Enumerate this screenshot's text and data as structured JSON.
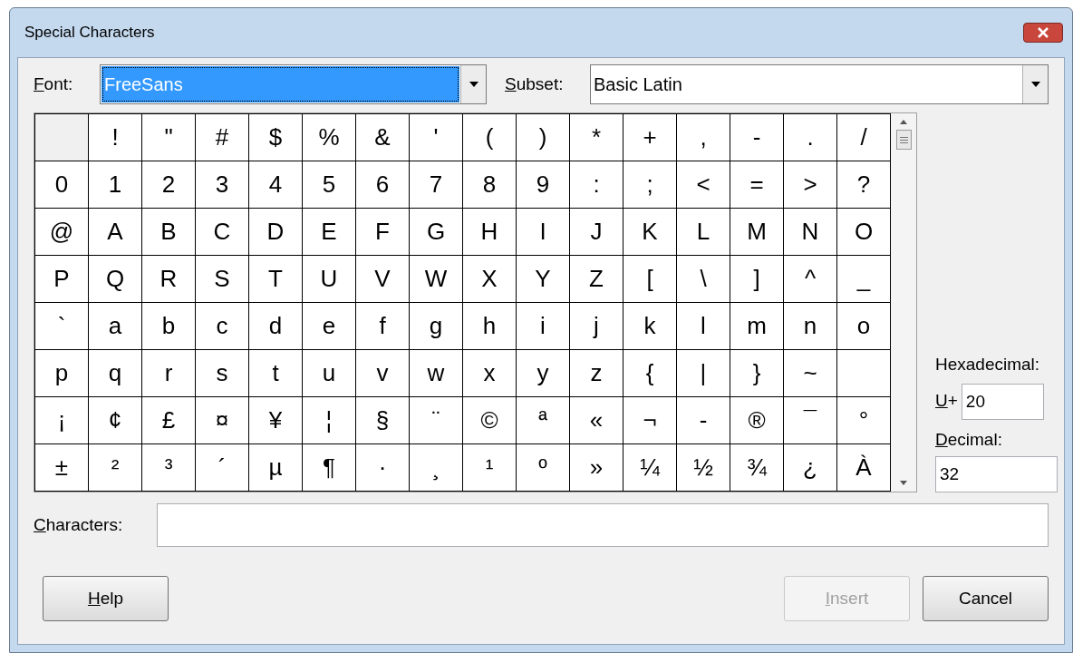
{
  "window": {
    "title": "Special Characters"
  },
  "font": {
    "label": "Font:",
    "mnemonic": true,
    "value": "FreeSans",
    "focused": true
  },
  "subset": {
    "label": "Subset:",
    "mnemonic": true,
    "value": "Basic Latin",
    "focused": false
  },
  "grid": {
    "rows": [
      [
        {
          "selected": true
        },
        {
          "char": "!",
          "selected": false
        },
        {
          "char": "\"",
          "selected": false
        },
        {
          "char": "#",
          "selected": false
        },
        {
          "char": "$",
          "selected": false
        },
        {
          "char": "%",
          "selected": false
        },
        {
          "char": "&",
          "selected": false
        },
        {
          "char": "'",
          "selected": false
        },
        {
          "char": "(",
          "selected": false
        },
        {
          "char": ")",
          "selected": false
        },
        {
          "char": "*",
          "selected": false
        },
        {
          "char": "+",
          "selected": false
        },
        {
          "char": ",",
          "selected": false
        },
        {
          "char": "-",
          "selected": false
        },
        {
          "char": ".",
          "selected": false
        },
        {
          "char": "/",
          "selected": false
        }
      ],
      [
        {
          "char": "0",
          "selected": false
        },
        {
          "char": "1",
          "selected": false
        },
        {
          "char": "2",
          "selected": false
        },
        {
          "char": "3",
          "selected": false
        },
        {
          "char": "4",
          "selected": false
        },
        {
          "char": "5",
          "selected": false
        },
        {
          "char": "6",
          "selected": false
        },
        {
          "char": "7",
          "selected": false
        },
        {
          "char": "8",
          "selected": false
        },
        {
          "char": "9",
          "selected": false
        },
        {
          "char": ":",
          "selected": false
        },
        {
          "char": ";",
          "selected": false
        },
        {
          "char": "<",
          "selected": false
        },
        {
          "char": "=",
          "selected": false
        },
        {
          "char": ">",
          "selected": false
        },
        {
          "char": "?",
          "selected": false
        }
      ],
      [
        {
          "char": "@",
          "selected": false
        },
        {
          "char": "A",
          "selected": false
        },
        {
          "char": "B",
          "selected": false
        },
        {
          "char": "C",
          "selected": false
        },
        {
          "char": "D",
          "selected": false
        },
        {
          "char": "E",
          "selected": false
        },
        {
          "char": "F",
          "selected": false
        },
        {
          "char": "G",
          "selected": false
        },
        {
          "char": "H",
          "selected": false
        },
        {
          "char": "I",
          "selected": false
        },
        {
          "char": "J",
          "selected": false
        },
        {
          "char": "K",
          "selected": false
        },
        {
          "char": "L",
          "selected": false
        },
        {
          "char": "M",
          "selected": false
        },
        {
          "char": "N",
          "selected": false
        },
        {
          "char": "O",
          "selected": false
        }
      ],
      [
        {
          "char": "P",
          "selected": false
        },
        {
          "char": "Q",
          "selected": false
        },
        {
          "char": "R",
          "selected": false
        },
        {
          "char": "S",
          "selected": false
        },
        {
          "char": "T",
          "selected": false
        },
        {
          "char": "U",
          "selected": false
        },
        {
          "char": "V",
          "selected": false
        },
        {
          "char": "W",
          "selected": false
        },
        {
          "char": "X",
          "selected": false
        },
        {
          "char": "Y",
          "selected": false
        },
        {
          "char": "Z",
          "selected": false
        },
        {
          "char": "[",
          "selected": false
        },
        {
          "char": "\\",
          "selected": false
        },
        {
          "char": "]",
          "selected": false
        },
        {
          "char": "^",
          "selected": false
        },
        {
          "char": "_",
          "selected": false
        }
      ],
      [
        {
          "char": "`",
          "selected": false
        },
        {
          "char": "a",
          "selected": false
        },
        {
          "char": "b",
          "selected": false
        },
        {
          "char": "c",
          "selected": false
        },
        {
          "char": "d",
          "selected": false
        },
        {
          "char": "e",
          "selected": false
        },
        {
          "char": "f",
          "selected": false
        },
        {
          "char": "g",
          "selected": false
        },
        {
          "char": "h",
          "selected": false
        },
        {
          "char": "i",
          "selected": false
        },
        {
          "char": "j",
          "selected": false
        },
        {
          "char": "k",
          "selected": false
        },
        {
          "char": "l",
          "selected": false
        },
        {
          "char": "m",
          "selected": false
        },
        {
          "char": "n",
          "selected": false
        },
        {
          "char": "o",
          "selected": false
        }
      ],
      [
        {
          "char": "p",
          "selected": false
        },
        {
          "char": "q",
          "selected": false
        },
        {
          "char": "r",
          "selected": false
        },
        {
          "char": "s",
          "selected": false
        },
        {
          "char": "t",
          "selected": false
        },
        {
          "char": "u",
          "selected": false
        },
        {
          "char": "v",
          "selected": false
        },
        {
          "char": "w",
          "selected": false
        },
        {
          "char": "x",
          "selected": false
        },
        {
          "char": "y",
          "selected": false
        },
        {
          "char": "z",
          "selected": false
        },
        {
          "char": "{",
          "selected": false
        },
        {
          "char": "|",
          "selected": false
        },
        {
          "char": "}",
          "selected": false
        },
        {
          "char": "~",
          "selected": false
        },
        {
          "selected": false
        }
      ],
      [
        {
          "char": "¡",
          "selected": false
        },
        {
          "char": "¢",
          "selected": false
        },
        {
          "char": "£",
          "selected": false
        },
        {
          "char": "¤",
          "selected": false
        },
        {
          "char": "¥",
          "selected": false
        },
        {
          "char": "¦",
          "selected": false
        },
        {
          "char": "§",
          "selected": false
        },
        {
          "char": "¨",
          "selected": false
        },
        {
          "char": "©",
          "selected": false
        },
        {
          "char": "ª",
          "selected": false
        },
        {
          "char": "«",
          "selected": false
        },
        {
          "char": "¬",
          "selected": false
        },
        {
          "char": "-",
          "selected": false
        },
        {
          "char": "®",
          "selected": false
        },
        {
          "char": "¯",
          "selected": false
        },
        {
          "char": "°",
          "selected": false
        }
      ],
      [
        {
          "char": "±",
          "selected": false
        },
        {
          "char": "²",
          "selected": false
        },
        {
          "char": "³",
          "selected": false
        },
        {
          "char": "´",
          "selected": false
        },
        {
          "char": "µ",
          "selected": false
        },
        {
          "char": "¶",
          "selected": false
        },
        {
          "char": "·",
          "selected": false
        },
        {
          "char": "¸",
          "selected": false
        },
        {
          "char": "¹",
          "selected": false
        },
        {
          "char": "º",
          "selected": false
        },
        {
          "char": "»",
          "selected": false
        },
        {
          "char": "¼",
          "selected": false
        },
        {
          "char": "½",
          "selected": false
        },
        {
          "char": "¾",
          "selected": false
        },
        {
          "char": "¿",
          "selected": false
        },
        {
          "char": "À",
          "selected": false
        }
      ]
    ]
  },
  "hexadecimal": {
    "label": "Hexadecimal:",
    "prefix": "U+",
    "mnemonic": true,
    "value": "20"
  },
  "decimal": {
    "label": "Decimal:",
    "mnemonic": true,
    "value": "32"
  },
  "characters": {
    "label": "Characters:",
    "mnemonic": true
  },
  "buttons": [
    {
      "label": "Help",
      "mnemonic": true,
      "disabled": false
    },
    {
      "label": "Insert",
      "mnemonic": true,
      "disabled": true
    },
    {
      "label": "Cancel",
      "mnemonic": false,
      "disabled": false
    }
  ]
}
